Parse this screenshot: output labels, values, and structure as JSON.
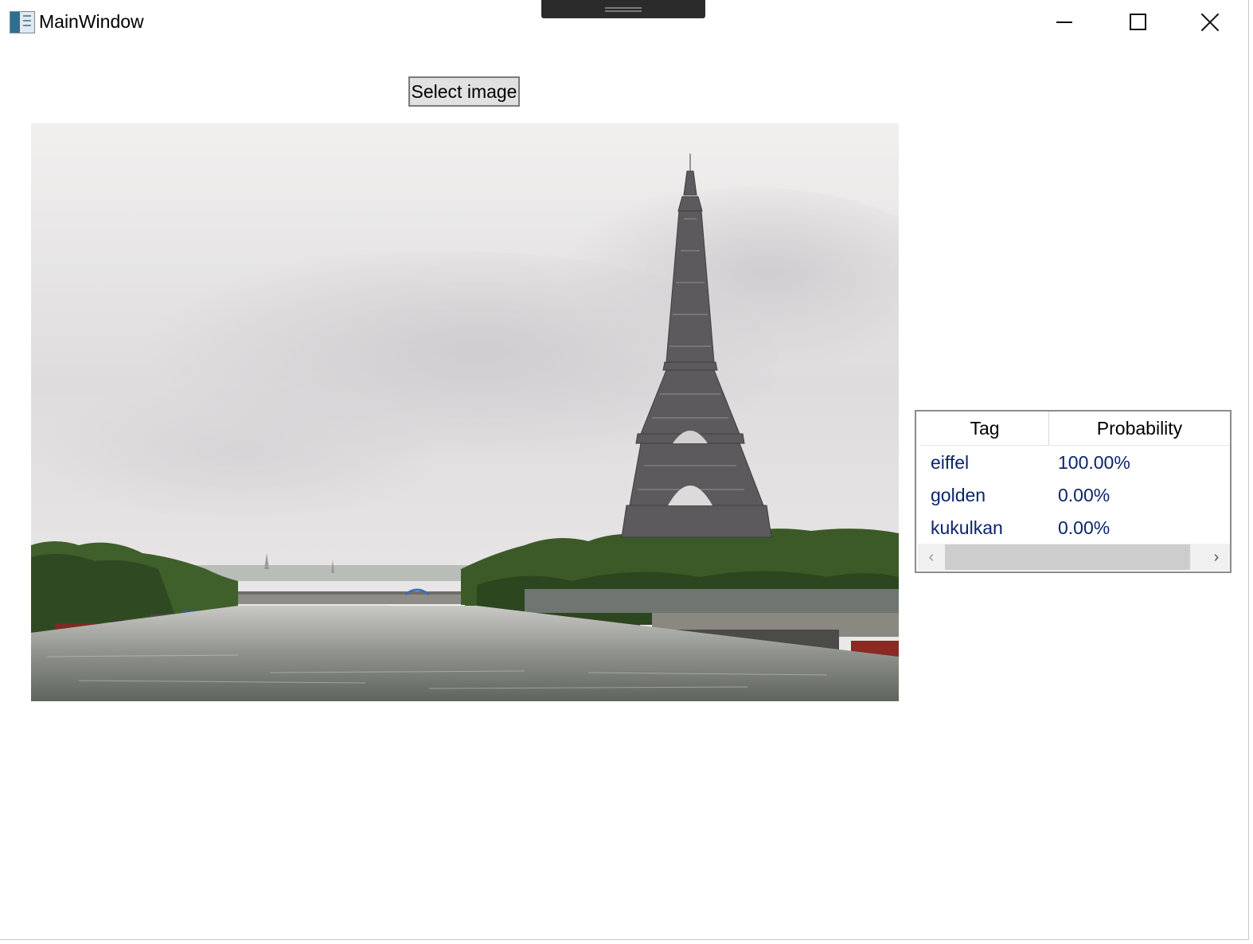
{
  "window": {
    "title": "MainWindow",
    "app_icon": "window-app-icon",
    "controls": {
      "minimize": "minimize-icon",
      "maximize": "maximize-icon",
      "close": "close-icon"
    }
  },
  "toolbar": {
    "select_image_label": "Select image"
  },
  "image": {
    "subject": "photo of river with tower on the right bank under an overcast sky"
  },
  "results": {
    "columns": [
      "Tag",
      "Probability"
    ],
    "rows": [
      {
        "tag": "eiffel",
        "probability": "100.00%"
      },
      {
        "tag": "golden",
        "probability": "0.00%"
      },
      {
        "tag": "kukulkan",
        "probability": "0.00%"
      }
    ],
    "scroll_left_icon": "chevron-left-icon",
    "scroll_right_icon": "chevron-right-icon"
  },
  "colors": {
    "cell_text": "#0a246a",
    "button_bg": "#e1e1e1",
    "border": "#8c8c8c"
  }
}
